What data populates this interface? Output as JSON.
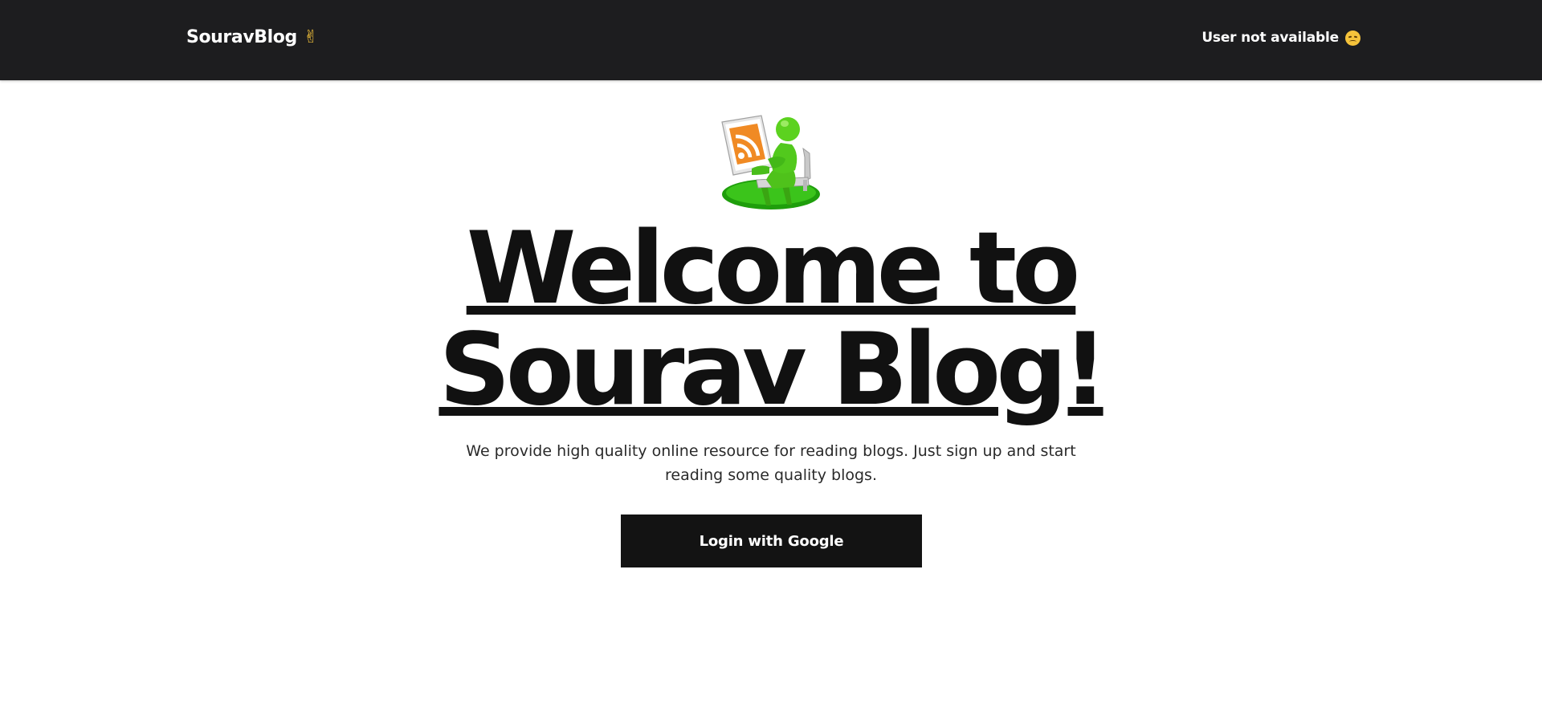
{
  "navbar": {
    "brand": "SouravBlog",
    "brand_icon": "victory-hand-icon",
    "brand_icon_glyph": "✌",
    "user_status": "User not available",
    "user_status_icon": "disappointed-face-icon"
  },
  "hero": {
    "illustration": "rss-reader-illustration",
    "title": "Welcome to Sourav Blog!",
    "description": "We provide high quality online resource for reading blogs. Just sign up and start reading some quality blogs.",
    "login_button": "Login with Google"
  },
  "colors": {
    "navbar_bg": "#1d1d1f",
    "button_bg": "#131313",
    "text_dark": "#111111",
    "emoji_yellow": "#f5c33b",
    "rss_orange": "#f08a24",
    "figure_green": "#4fc21b"
  }
}
